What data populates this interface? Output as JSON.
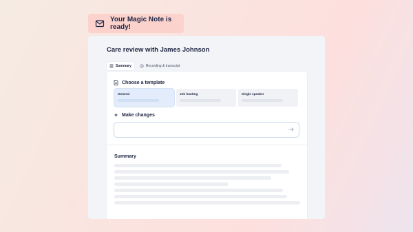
{
  "toast": {
    "text": "Your Magic Note is ready!",
    "icon": "envelope-icon"
  },
  "card": {
    "title": "Care review with James Johnson",
    "tabs": [
      {
        "label": "Summary",
        "icon": "list-icon",
        "active": true
      },
      {
        "label": "Recording & transcript",
        "icon": "waveform-icon",
        "active": false
      }
    ]
  },
  "template_section": {
    "heading": "Choose a template",
    "icon": "document-icon",
    "options": [
      {
        "label": "General",
        "selected": true
      },
      {
        "label": "Job hunting",
        "selected": false
      },
      {
        "label": "Single speaker",
        "selected": false
      }
    ]
  },
  "changes_section": {
    "heading": "Make changes",
    "icon": "sparkle-icon",
    "input_value": "",
    "submit_icon": "arrow-right-icon"
  },
  "summary": {
    "heading": "Summary"
  },
  "colors": {
    "accent": "#bcd3f2",
    "toast_bg": "#fbd2cc",
    "text": "#1c2340"
  }
}
